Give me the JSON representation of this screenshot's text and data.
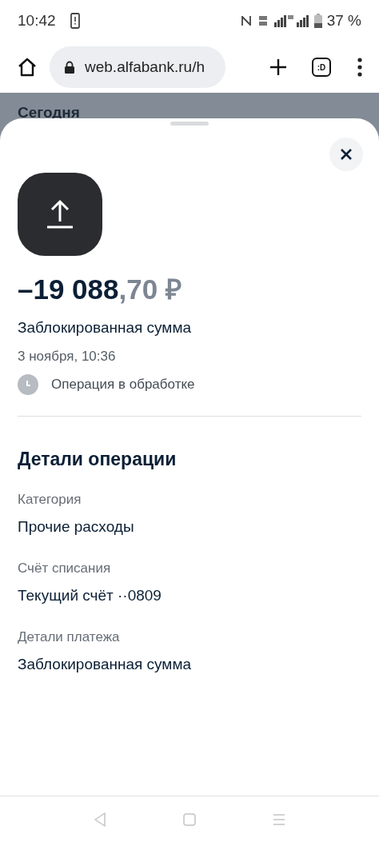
{
  "status_bar": {
    "time": "10:42",
    "battery": "37 %"
  },
  "browser": {
    "url": "web.alfabank.ru/h",
    "tabs_label": ":D"
  },
  "background": {
    "section_title": "Сегодня"
  },
  "sheet": {
    "amount_main": "–19 088",
    "amount_fraction": ",70 ₽",
    "title": "Заблокированная сумма",
    "datetime": "3 ноября, 10:36",
    "status": "Операция в обработке",
    "details_title": "Детали операции",
    "details": [
      {
        "label": "Категория",
        "value": "Прочие расходы"
      },
      {
        "label": "Счёт списания",
        "value": "Текущий счёт ··0809"
      },
      {
        "label": "Детали платежа",
        "value": "Заблокированная сумма"
      }
    ]
  }
}
